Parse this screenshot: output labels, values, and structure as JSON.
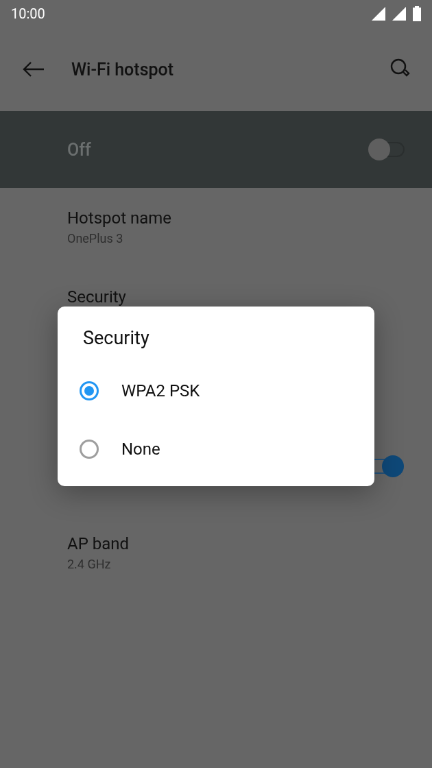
{
  "status_bar": {
    "time": "10:00"
  },
  "app_bar": {
    "title": "Wi-Fi hotspot"
  },
  "master_switch": {
    "label": "Off",
    "on": false
  },
  "settings": [
    {
      "kind": "text",
      "title": "Hotspot name",
      "summary": "OnePlus 3"
    },
    {
      "kind": "text",
      "title": "Security"
    },
    {
      "kind": "switch",
      "on": true
    },
    {
      "kind": "text",
      "title": "AP band",
      "summary": "2.4 GHz"
    }
  ],
  "dialog": {
    "title": "Security",
    "options": [
      {
        "label": "WPA2 PSK",
        "selected": true
      },
      {
        "label": "None",
        "selected": false
      }
    ]
  }
}
